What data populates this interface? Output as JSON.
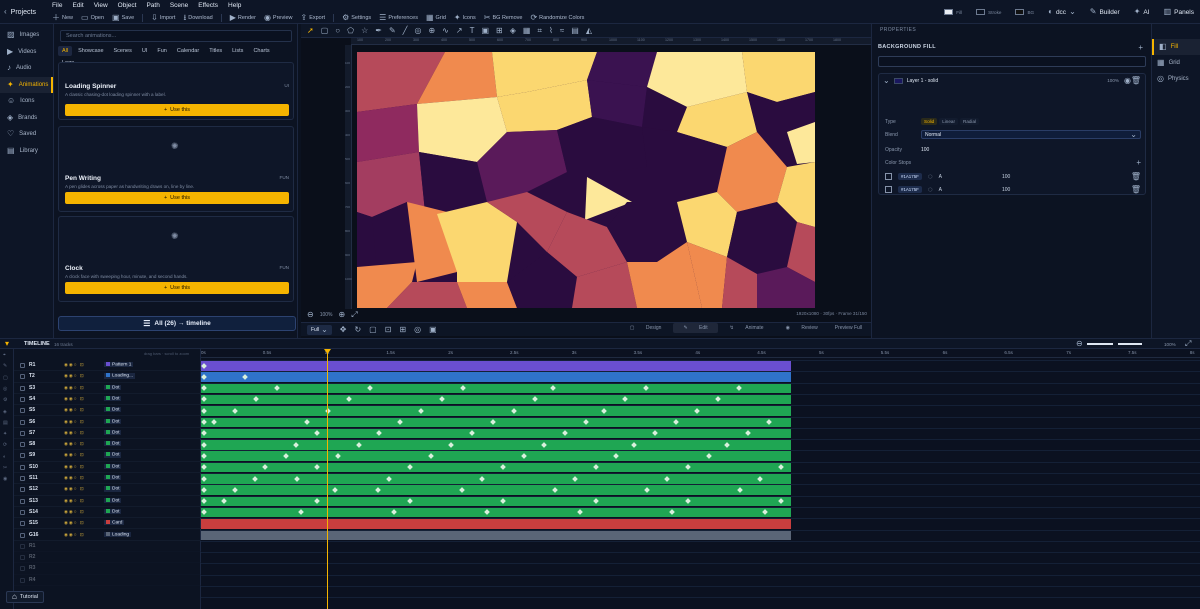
{
  "menu": {
    "projects": "Projects",
    "items": [
      "File",
      "Edit",
      "View",
      "Object",
      "Path",
      "Scene",
      "Effects",
      "Help"
    ]
  },
  "toolbar": [
    "New",
    "Open",
    "Save",
    "Import",
    "Download",
    "Render",
    "Preview",
    "Export",
    "Settings",
    "Preferences",
    "Grid",
    "Icons",
    "BG Remove",
    "Randomize Colors"
  ],
  "top_right": {
    "fill": "Fill",
    "stroke": "Stroke",
    "bg": "BG",
    "theme": "dcc",
    "builder": "Builder",
    "ai": "AI",
    "panels": "Panels"
  },
  "rail": [
    {
      "label": "Images"
    },
    {
      "label": "Videos"
    },
    {
      "label": "Audio"
    },
    {
      "label": "Animations",
      "active": true
    },
    {
      "label": "Icons"
    },
    {
      "label": "Brands"
    },
    {
      "label": "Saved"
    },
    {
      "label": "Library"
    }
  ],
  "anim": {
    "search_placeholder": "Search animations...",
    "categories": [
      {
        "label": "All",
        "on": true
      },
      {
        "label": "Showcase"
      },
      {
        "label": "Scenes"
      },
      {
        "label": "UI"
      },
      {
        "label": "Fun"
      },
      {
        "label": "Calendar"
      },
      {
        "label": "Titles"
      },
      {
        "label": "Lists"
      },
      {
        "label": "Charts"
      },
      {
        "label": "Logo"
      }
    ],
    "cards": [
      {
        "title": "Loading Spinner",
        "desc": "A classic chasing-dot loading spinner with a label.",
        "badge": "UI",
        "btn": "Use this"
      },
      {
        "title": "Pen Writing",
        "desc": "A pen glides across paper as handwriting draws on, line by line.",
        "badge": "FUN",
        "btn": "Use this"
      },
      {
        "title": "Clock",
        "desc": "A clock face with sweeping hour, minute, and second hands.",
        "badge": "FUN",
        "btn": "Use this"
      }
    ],
    "all_button": "All (26) → timeline"
  },
  "canvas": {
    "zoom": "100%",
    "status": "1920x1080 · 30fps · Frame 31/150",
    "size_mode": "Full",
    "modes": [
      {
        "label": "Design"
      },
      {
        "label": "Edit",
        "on": true
      },
      {
        "label": "Animate"
      },
      {
        "label": "Review"
      }
    ],
    "preview_full": "Preview Full",
    "ruler_top": [
      "100",
      "200",
      "300",
      "400",
      "500",
      "600",
      "700",
      "800",
      "900",
      "1000",
      "1100",
      "1200",
      "1300",
      "1400",
      "1500",
      "1600",
      "1700",
      "1800"
    ],
    "ruler_left": [
      "100",
      "200",
      "300",
      "400",
      "500",
      "600",
      "700",
      "800",
      "900",
      "1000"
    ]
  },
  "props": {
    "tab": "PROPERTIES",
    "title": "BACKGROUND FILL",
    "layer": "Layer 1 - solid",
    "layer_pct": "100%",
    "type_label": "Type",
    "types": [
      {
        "label": "Solid",
        "on": true
      },
      {
        "label": "Linear"
      },
      {
        "label": "Radial"
      }
    ],
    "blend_label": "Blend",
    "blend_value": "Normal",
    "opacity_label": "Opacity",
    "opacity_value": "100",
    "stops_label": "Color Stops",
    "stops": [
      {
        "hex": "#1A175F",
        "alpha": "A",
        "value": "100"
      },
      {
        "hex": "#1A175F",
        "alpha": "A",
        "value": "100"
      }
    ]
  },
  "rtabs": [
    {
      "label": "Fill",
      "on": true
    },
    {
      "label": "Grid"
    },
    {
      "label": "Physics"
    }
  ],
  "timeline": {
    "title": "TIMELINE",
    "count": "16 tracks",
    "hint": "drag bars · scroll to zoom",
    "zoom": "100%",
    "ruler": [
      "0s",
      "0.5s",
      "1s",
      "1.5s",
      "2s",
      "2.5s",
      "3s",
      "3.5s",
      "4s",
      "4.5s",
      "5s",
      "5.5s",
      "6s",
      "6.5s",
      "7s",
      "7.5s",
      "8s"
    ],
    "tracks": [
      {
        "name": "R1",
        "tag": "Pattern 1",
        "color": "#6a4fd0",
        "keys": [
          0
        ]
      },
      {
        "name": "T2",
        "tag": "Loading...",
        "color": "#2f73c9",
        "keys": [
          0,
          41
        ]
      },
      {
        "name": "S3",
        "tag": "Dot",
        "color": "#1fa653",
        "keys": [
          0,
          73,
          166,
          259,
          349,
          442,
          535
        ]
      },
      {
        "name": "S4",
        "tag": "Dot",
        "color": "#1fa653",
        "keys": [
          0,
          52,
          145,
          238,
          331,
          421,
          514
        ]
      },
      {
        "name": "S5",
        "tag": "Dot",
        "color": "#1fa653",
        "keys": [
          0,
          31,
          124,
          217,
          310,
          400,
          493
        ]
      },
      {
        "name": "S6",
        "tag": "Dot",
        "color": "#1fa653",
        "keys": [
          0,
          10,
          103,
          196,
          289,
          382,
          472,
          565
        ]
      },
      {
        "name": "S7",
        "tag": "Dot",
        "color": "#1fa653",
        "keys": [
          0,
          113,
          175,
          268,
          361,
          451,
          544
        ]
      },
      {
        "name": "S8",
        "tag": "Dot",
        "color": "#1fa653",
        "keys": [
          0,
          92,
          155,
          247,
          340,
          430,
          523
        ]
      },
      {
        "name": "S9",
        "tag": "Dot",
        "color": "#1fa653",
        "keys": [
          0,
          82,
          134,
          227,
          320,
          412,
          505
        ]
      },
      {
        "name": "S10",
        "tag": "Dot",
        "color": "#1fa653",
        "keys": [
          0,
          61,
          113,
          206,
          299,
          392,
          484,
          577
        ]
      },
      {
        "name": "S11",
        "tag": "Dot",
        "color": "#1fa653",
        "keys": [
          0,
          51,
          93,
          185,
          278,
          371,
          463,
          556
        ]
      },
      {
        "name": "S12",
        "tag": "Dot",
        "color": "#1fa653",
        "keys": [
          0,
          31,
          131,
          174,
          258,
          351,
          443,
          536
        ]
      },
      {
        "name": "S13",
        "tag": "Dot",
        "color": "#1fa653",
        "keys": [
          0,
          20,
          113,
          206,
          299,
          392,
          484,
          577
        ]
      },
      {
        "name": "S14",
        "tag": "Dot",
        "color": "#1fa653",
        "keys": [
          0,
          97,
          190,
          283,
          376,
          468,
          561
        ]
      },
      {
        "name": "S15",
        "tag": "Card",
        "color": "#c83e3e",
        "keys": []
      },
      {
        "name": "G16",
        "tag": "Loading",
        "color": "#5a6577",
        "keys": []
      }
    ],
    "empty_rows": [
      "R1",
      "R2",
      "R3",
      "R4"
    ]
  },
  "tutorial": "Tutorial"
}
